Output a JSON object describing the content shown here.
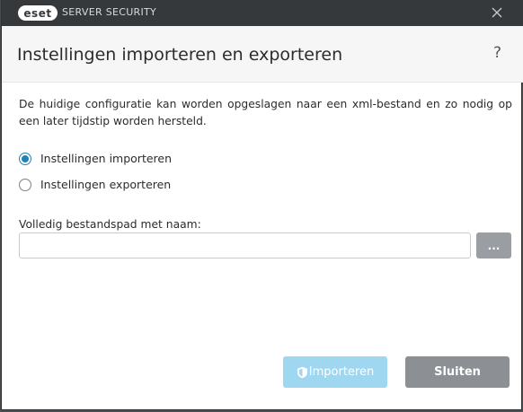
{
  "titlebar": {
    "logo_text": "eset",
    "product_name": "SERVER SECURITY"
  },
  "header": {
    "title": "Instellingen importeren en exporteren",
    "help_symbol": "?"
  },
  "body": {
    "description": "De huidige configuratie kan worden opgeslagen naar een xml-bestand en zo nodig op een later tijdstip worden hersteld.",
    "options": [
      {
        "label": "Instellingen importeren",
        "selected": true
      },
      {
        "label": "Instellingen exporteren",
        "selected": false
      }
    ],
    "path_label": "Volledig bestandspad met naam:",
    "path_value": "",
    "browse_label": "..."
  },
  "footer": {
    "import_label": "Importeren",
    "close_label": "Sluiten"
  },
  "colors": {
    "titlebar": "#36393c",
    "accent": "#1f83b5",
    "import_disabled": "#9fd6f0",
    "close_button": "#8c9094"
  },
  "icons": {
    "close": "close-icon",
    "help": "help-icon",
    "import": "shield-icon"
  }
}
